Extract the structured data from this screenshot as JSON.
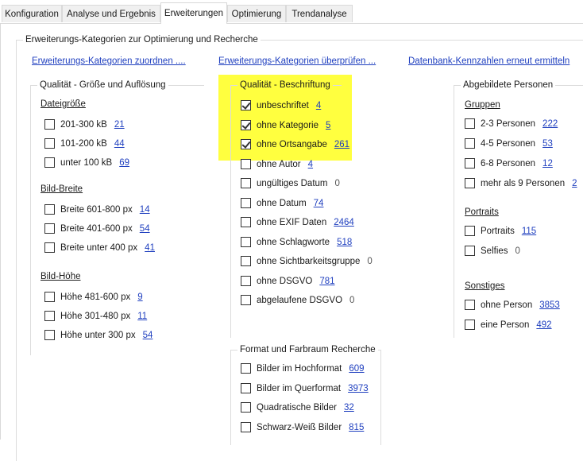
{
  "tabs": [
    {
      "label": "Konfiguration",
      "active": false
    },
    {
      "label": "Analyse und Ergebnis",
      "active": false
    },
    {
      "label": "Erweiterungen",
      "active": true
    },
    {
      "label": "Optimierung",
      "active": false
    },
    {
      "label": "Trendanalyse",
      "active": false
    }
  ],
  "outer_group": {
    "title": "Erweiterungs-Kategorien zur Optimierung und Recherche"
  },
  "links": {
    "assign": "Erweiterungs-Kategorien zuordnen ....",
    "check": "Erweiterungs-Kategorien überprüfen ...",
    "recompute": "Datenbank-Kennzahlen erneut ermitteln"
  },
  "quality_size": {
    "title": "Qualität - Größe und Auflösung",
    "sections": [
      {
        "heading": "Dateigröße",
        "items": [
          {
            "label": "201-300 kB",
            "count": "21",
            "checked": false
          },
          {
            "label": "101-200 kB",
            "count": "44",
            "checked": false
          },
          {
            "label": "unter 100 kB",
            "count": "69",
            "checked": false
          }
        ]
      },
      {
        "heading": "Bild-Breite",
        "items": [
          {
            "label": "Breite 601-800 px",
            "count": "14",
            "checked": false
          },
          {
            "label": "Breite 401-600 px",
            "count": "54",
            "checked": false
          },
          {
            "label": "Breite unter 400 px",
            "count": "41",
            "checked": false
          }
        ]
      },
      {
        "heading": "Bild-Höhe",
        "items": [
          {
            "label": "Höhe 481-600 px",
            "count": "9",
            "checked": false
          },
          {
            "label": "Höhe 301-480 px",
            "count": "11",
            "checked": false
          },
          {
            "label": "Höhe unter 300 px",
            "count": "54",
            "checked": false
          }
        ]
      }
    ]
  },
  "quality_label": {
    "title": "Qualität - Beschriftung",
    "items": [
      {
        "label": "unbeschriftet",
        "count": "4",
        "checked": true
      },
      {
        "label": "ohne Kategorie",
        "count": "5",
        "checked": true
      },
      {
        "label": "ohne Ortsangabe",
        "count": "261",
        "checked": true
      },
      {
        "label": "ohne Autor",
        "count": "4",
        "checked": false
      },
      {
        "label": "ungültiges Datum",
        "count": "0",
        "checked": false
      },
      {
        "label": "ohne Datum",
        "count": "74",
        "checked": false
      },
      {
        "label": "ohne EXIF Daten",
        "count": "2464",
        "checked": false
      },
      {
        "label": "ohne Schlagworte",
        "count": "518",
        "checked": false
      },
      {
        "label": "ohne Sichtbarkeitsgruppe",
        "count": "0",
        "checked": false
      },
      {
        "label": "ohne DSGVO",
        "count": "781",
        "checked": false
      },
      {
        "label": "abgelaufene DSGVO",
        "count": "0",
        "checked": false
      }
    ]
  },
  "format": {
    "title": "Format und Farbraum Recherche",
    "items": [
      {
        "label": "Bilder im Hochformat",
        "count": "609",
        "checked": false
      },
      {
        "label": "Bilder im Querformat",
        "count": "3973",
        "checked": false
      },
      {
        "label": "Quadratische Bilder",
        "count": "32",
        "checked": false
      },
      {
        "label": "Schwarz-Weiß Bilder",
        "count": "815",
        "checked": false
      }
    ]
  },
  "persons": {
    "title": "Abgebildete Personen",
    "sections": [
      {
        "heading": "Gruppen",
        "items": [
          {
            "label": "2-3 Personen",
            "count": "222",
            "checked": false
          },
          {
            "label": "4-5 Personen",
            "count": "53",
            "checked": false
          },
          {
            "label": "6-8 Personen",
            "count": "12",
            "checked": false
          },
          {
            "label": "mehr als 9 Personen",
            "count": "2",
            "checked": false
          }
        ]
      },
      {
        "heading": "Portraits",
        "items": [
          {
            "label": "Portraits",
            "count": "115",
            "checked": false
          },
          {
            "label": "Selfies",
            "count": "0",
            "checked": false
          }
        ]
      },
      {
        "heading": "Sonstiges",
        "items": [
          {
            "label": "ohne Person",
            "count": "3853",
            "checked": false
          },
          {
            "label": "eine Person",
            "count": "492",
            "checked": false
          }
        ]
      }
    ]
  },
  "colors": {
    "highlight": "#ffff3f",
    "link": "#1f3fbf"
  }
}
